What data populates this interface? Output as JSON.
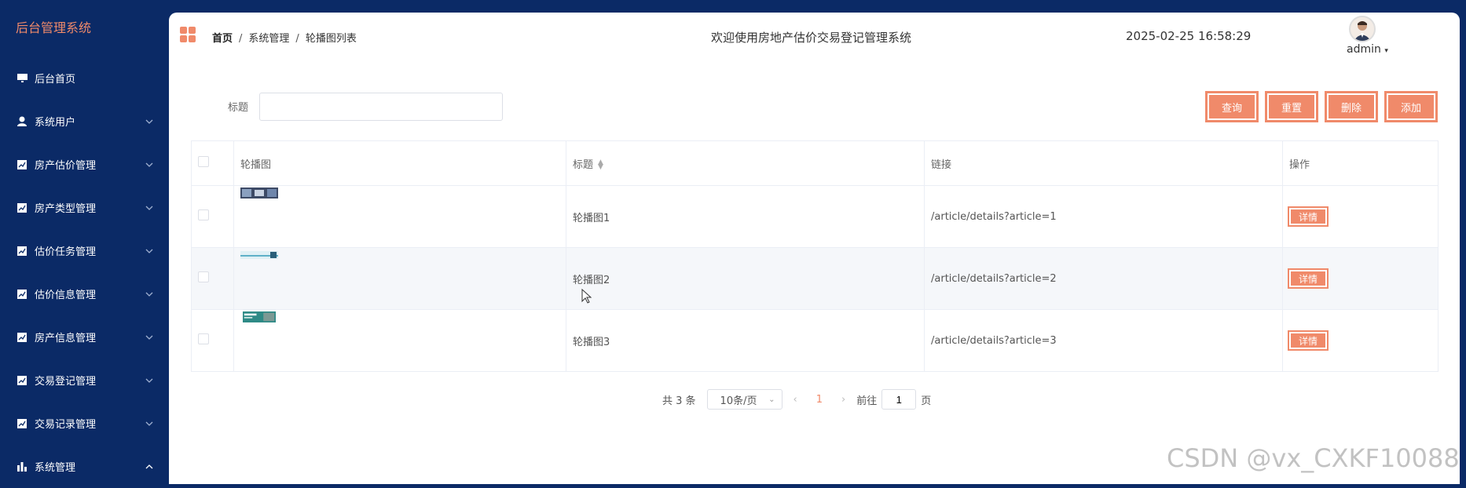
{
  "sidebar": {
    "brand": "后台管理系统",
    "items": [
      {
        "label": "后台首页",
        "icon": "monitor-icon"
      },
      {
        "label": "系统用户",
        "icon": "user-icon"
      },
      {
        "label": "房产估价管理",
        "icon": "chart-icon"
      },
      {
        "label": "房产类型管理",
        "icon": "chart-icon"
      },
      {
        "label": "估价任务管理",
        "icon": "chart-icon"
      },
      {
        "label": "估价信息管理",
        "icon": "chart-icon"
      },
      {
        "label": "房产信息管理",
        "icon": "chart-icon"
      },
      {
        "label": "交易登记管理",
        "icon": "chart-icon"
      },
      {
        "label": "交易记录管理",
        "icon": "chart-icon"
      },
      {
        "label": "系统管理",
        "icon": "bar-chart-icon"
      }
    ]
  },
  "header": {
    "breadcrumb": [
      "首页",
      "系统管理",
      "轮播图列表"
    ],
    "welcome": "欢迎使用房地产估价交易登记管理系统",
    "datetime": "2025-02-25 16:58:29",
    "username": "admin"
  },
  "search": {
    "label": "标题",
    "value": "",
    "placeholder": ""
  },
  "buttons": {
    "query": "查询",
    "reset": "重置",
    "delete": "删除",
    "add": "添加"
  },
  "table": {
    "columns": [
      "轮播图",
      "标题",
      "链接",
      "操作"
    ],
    "rows": [
      {
        "title": "轮播图1",
        "link": "/article/details?article=1",
        "action": "详情"
      },
      {
        "title": "轮播图2",
        "link": "/article/details?article=2",
        "action": "详情"
      },
      {
        "title": "轮播图3",
        "link": "/article/details?article=3",
        "action": "详情"
      }
    ]
  },
  "pagination": {
    "total": "共 3 条",
    "page_size": "10条/页",
    "current_page": "1",
    "goto_label": "前往",
    "goto_value": "1",
    "page_suffix": "页"
  },
  "watermark": "CSDN @vx_CXKF10088",
  "colors": {
    "accent": "#f08a6a",
    "sidebar": "#0b2a66"
  }
}
